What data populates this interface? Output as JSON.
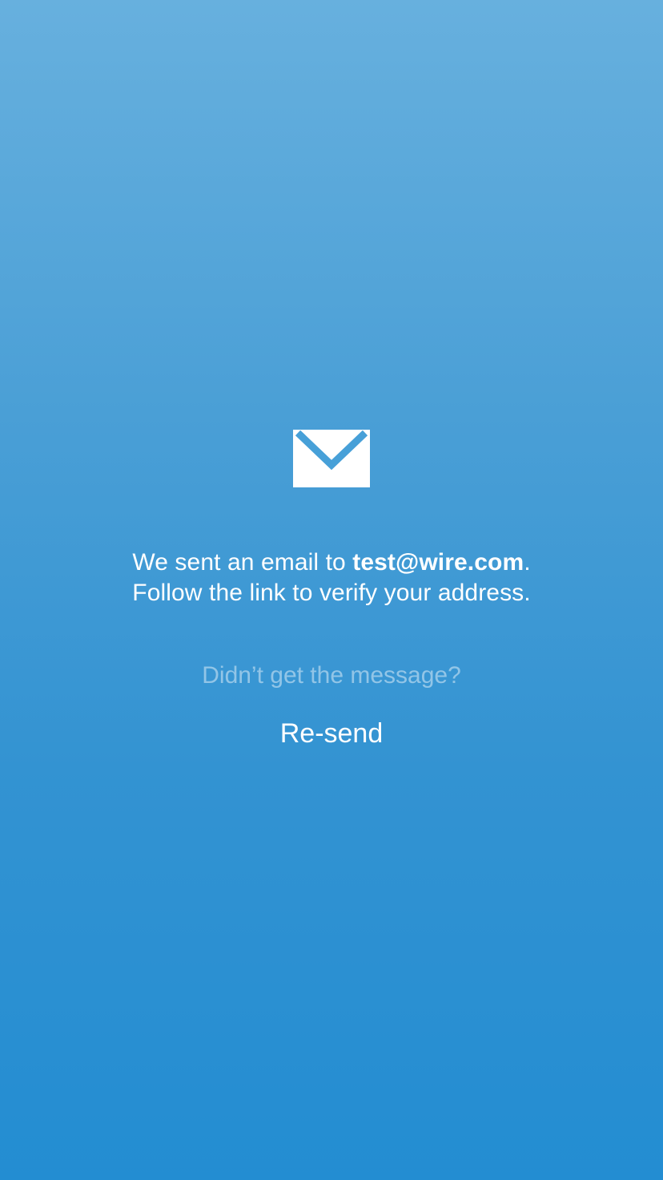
{
  "icon": "envelope-icon",
  "colors": {
    "background_top": "#67b0de",
    "background_bottom": "#238dd2",
    "text": "#ffffff"
  },
  "message": {
    "prefix": "We sent an email to ",
    "email": "test@wire.com",
    "suffix": ".",
    "line2": "Follow the link to verify your address."
  },
  "resend": {
    "prompt": "Didn’t get the message?",
    "button_label": "Re-send"
  }
}
